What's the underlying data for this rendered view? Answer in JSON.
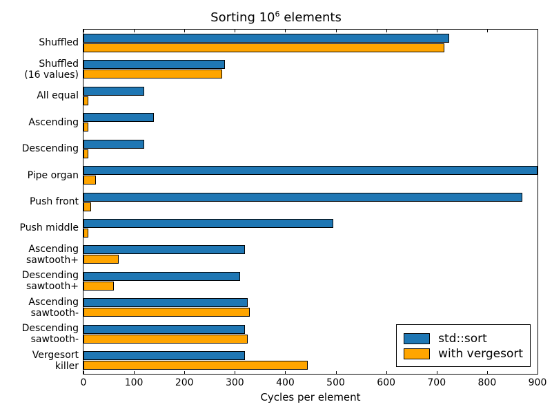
{
  "chart_data": {
    "type": "bar",
    "orientation": "horizontal",
    "title_prefix": "Sorting ",
    "title_base": "10",
    "title_exp": "6",
    "title_suffix": "  elements",
    "xlabel": "Cycles per element",
    "ylabel": "",
    "xlim": [
      0,
      900
    ],
    "xticks": [
      0,
      100,
      200,
      300,
      400,
      500,
      600,
      700,
      800,
      900
    ],
    "categories": [
      "Shuffled",
      "Shuffled\n(16 values)",
      "All equal",
      "Ascending",
      "Descending",
      "Pipe organ",
      "Push front",
      "Push middle",
      "Ascending\nsawtooth+",
      "Descending\nsawtooth+",
      "Ascending\nsawtooth-",
      "Descending\nsawtooth-",
      "Vergesort\nkiller"
    ],
    "series": [
      {
        "name": "std::sort",
        "color": "#1f77b4",
        "class": "std",
        "values": [
          725,
          280,
          120,
          140,
          120,
          900,
          870,
          495,
          320,
          310,
          325,
          320,
          320
        ]
      },
      {
        "name": " with vergesort",
        "color": "#ffa500",
        "class": "verge",
        "values": [
          715,
          275,
          10,
          10,
          10,
          25,
          15,
          10,
          70,
          60,
          330,
          325,
          445
        ]
      }
    ],
    "legend": {
      "items": [
        "std::sort",
        " with vergesort"
      ]
    }
  }
}
